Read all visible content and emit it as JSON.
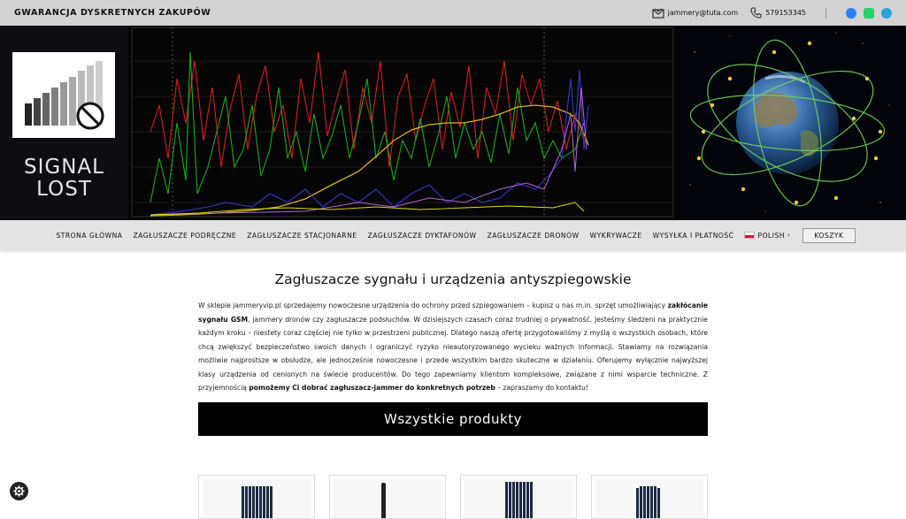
{
  "topbar": {
    "tagline": "GWARANCJA DYSKRETNYCH ZAKUPÓW",
    "email": "jammery@tuta.com",
    "phone": "579153345",
    "social": [
      {
        "name": "messenger-icon",
        "color": "#2d7ff9"
      },
      {
        "name": "whatsapp-icon",
        "color": "#25d366"
      },
      {
        "name": "telegram-icon",
        "color": "#2aa1da"
      }
    ]
  },
  "banner": {
    "logo_caption": "SIGNAL",
    "logo_caption2": "LOST"
  },
  "nav": {
    "items": [
      "STRONA GŁÓWNA",
      "ZAGŁUSZACZE PODRĘCZNE",
      "ZAGŁUSZACZE STACJONARNE",
      "ZAGŁUSZACZE DYKTAFONÓW",
      "ZAGŁUSZACZE DRONÓW",
      "WYKRYWACZE",
      "WYSYŁKA I PŁATNOŚĆ"
    ],
    "language": "POLISH",
    "cart": "KOSZYK"
  },
  "main": {
    "heading": "Zagłuszacze sygnału i urządzenia antyszpiegowskie",
    "intro_1": "W sklepie jammeryvip.pl sprzedajemy nowoczesne urządzenia do ochrony przed szpiegowaniem – kupisz u nas m.in. sprzęt umożliwiający ",
    "intro_bold_1": "zakłócanie sygnału GSM",
    "intro_2": ", jammery dronów czy zagłuszacze podsłuchów. W dzisiejszych czasach coraz trudniej o prywatność. Jesteśmy śledzeni na praktycznie każdym kroku – niestety coraz częściej nie tylko w przestrzeni publicznej. Dlatego naszą ofertę przygotowaliśmy z myślą o wszystkich osobach, które chcą zwiększyć bezpieczeństwo swoich danych i ograniczyć ryzyko nieautoryzowanego wycieku ważnych informacji. Stawiamy na rozwiązania możliwie najprostsze w obsłudze, ale jednocześnie nowoczesne i przede wszystkim bardzo skuteczne w działaniu. Oferujemy wyłącznie najwyższej klasy urządzenia od cenionych na świecie producentów. Do tego zapewniamy klientom kompleksowe, związane z nimi wsparcie techniczne. Z przyjemnością ",
    "intro_bold_2": "pomożemy Ci dobrać zagłuszacz-jammer do konkretnych potrzeb",
    "intro_3": " – zapraszamy do kontaktu!",
    "all_products": "Wszystkie produkty"
  }
}
